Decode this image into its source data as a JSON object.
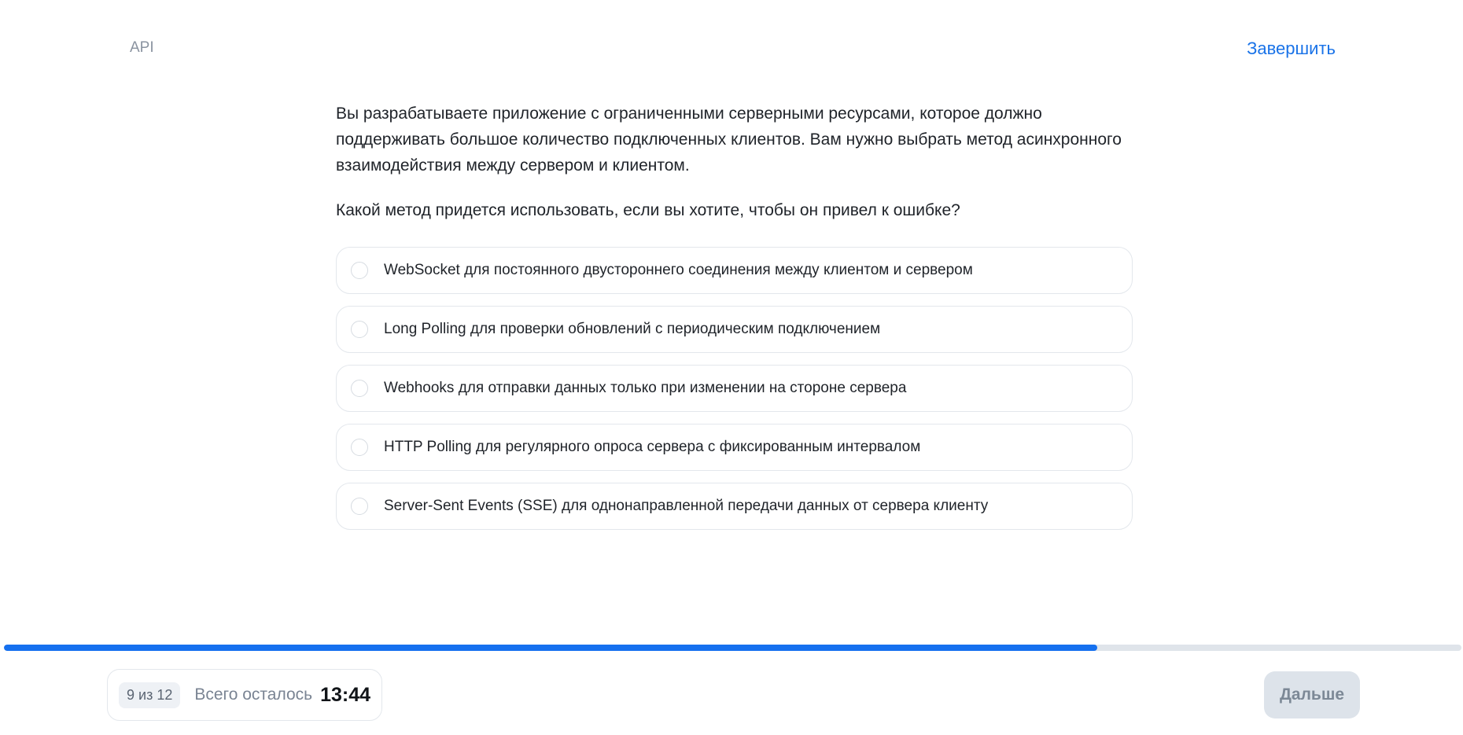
{
  "header": {
    "topic": "API",
    "finish_label": "Завершить"
  },
  "question": {
    "text": "Вы разрабатываете приложение с ограниченными серверными ресурсами, которое должно поддерживать большое количество подключенных клиентов. Вам нужно выбрать метод асинхронного взаимодействия между сервером и клиентом.",
    "prompt": "Какой метод придется использовать, если вы хотите, чтобы он привел к ошибке?"
  },
  "options": [
    {
      "label": "WebSocket для постоянного двустороннего соединения между клиентом и сервером",
      "selected": false
    },
    {
      "label": "Long Polling для проверки обновлений с периодическим подключением",
      "selected": false
    },
    {
      "label": "Webhooks для отправки данных только при изменении на стороне сервера",
      "selected": false
    },
    {
      "label": "HTTP Polling для регулярного опроса сервера с фиксированным интервалом",
      "selected": false
    },
    {
      "label": "Server-Sent Events (SSE) для однонаправленной передачи данных от сервера клиенту",
      "selected": false
    }
  ],
  "progress": {
    "current": 9,
    "total": 12,
    "fraction": 0.75,
    "counter_label": "9 из 12",
    "fill_color": "#1570ef",
    "track_color": "#dfe4ea"
  },
  "footer": {
    "remaining_label": "Всего осталось",
    "timer": "13:44",
    "next_label": "Дальше"
  },
  "colors": {
    "accent": "#1a73e8",
    "disabled_button_bg": "#dde3ea"
  }
}
